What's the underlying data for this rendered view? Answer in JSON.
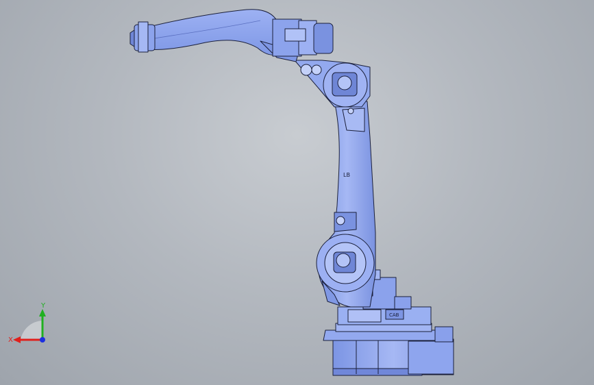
{
  "viewport": {
    "background_top": "#c8ccd1",
    "background_bottom": "#9ea4ac"
  },
  "model": {
    "body_color": "#8fa6ee",
    "shade_color": "#6f86d6",
    "edge_color": "#1a1f3a",
    "arm_label": "LB",
    "plate_label": "CAB"
  },
  "triad": {
    "x_label": "X",
    "y_label": "Y",
    "x_color": "#e0201c",
    "y_color": "#20b020",
    "z_color": "#1c2fe0"
  }
}
